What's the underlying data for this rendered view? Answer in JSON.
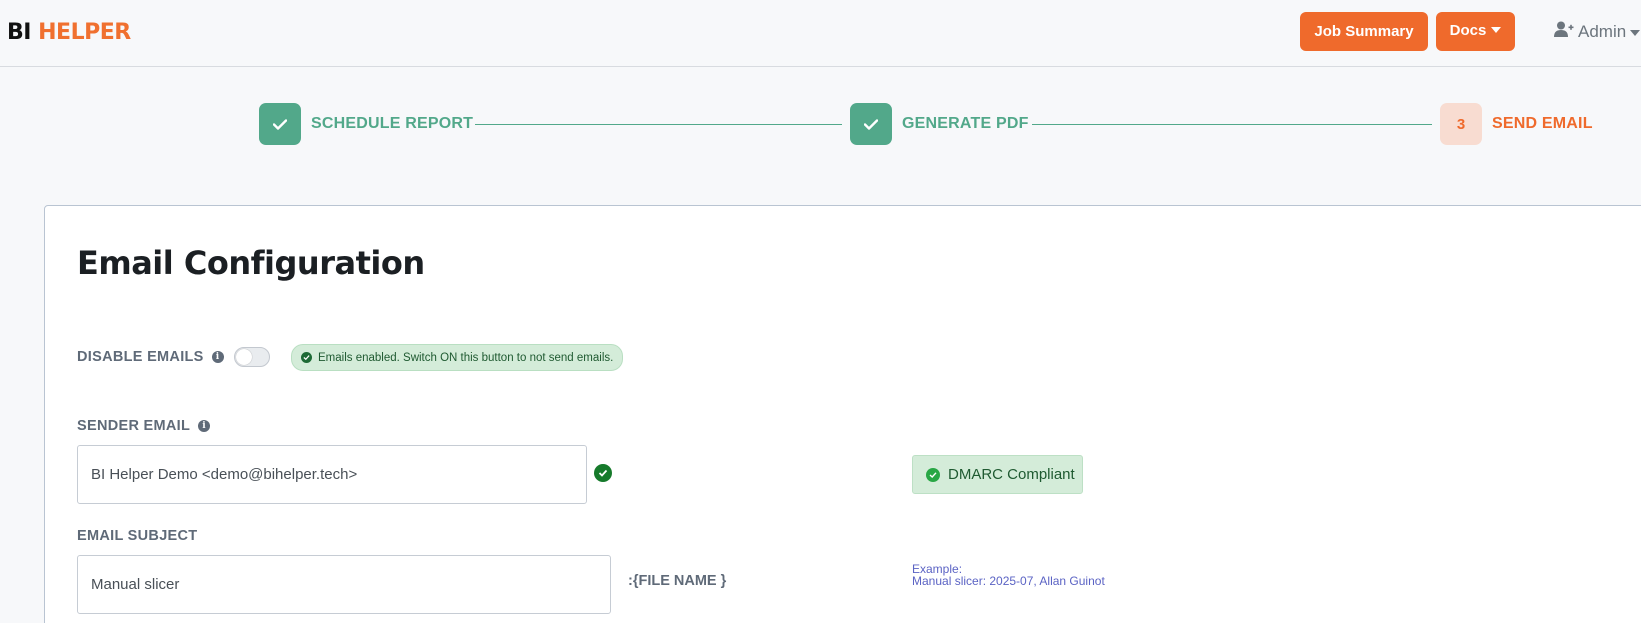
{
  "brand": {
    "part1": "BI",
    "part2": "HELPER",
    "accent_color": "#ef6a2c"
  },
  "header": {
    "job_summary_label": "Job Summary",
    "docs_label": "Docs",
    "admin_label": "Admin"
  },
  "stepper": {
    "steps": [
      {
        "label": "SCHEDULE REPORT",
        "status": "done"
      },
      {
        "label": "GENERATE PDF",
        "status": "done"
      },
      {
        "label": "SEND EMAIL",
        "status": "current",
        "number": "3"
      }
    ],
    "done_color": "#52a88a"
  },
  "email_config": {
    "title": "Email Configuration",
    "disable_emails": {
      "label": "DISABLE EMAILS",
      "enabled": false,
      "status_text": "Emails enabled. Switch ON this button to not send emails."
    },
    "sender": {
      "label": "SENDER EMAIL",
      "value": "BI Helper Demo <demo@bihelper.tech>",
      "dmarc_text": "DMARC Compliant"
    },
    "subject": {
      "label": "EMAIL SUBJECT",
      "value": "Manual slicer",
      "suffix": ":{FILE NAME }",
      "example_label": "Example:",
      "example_value": "Manual slicer: 2025-07, Allan Guinot"
    }
  }
}
